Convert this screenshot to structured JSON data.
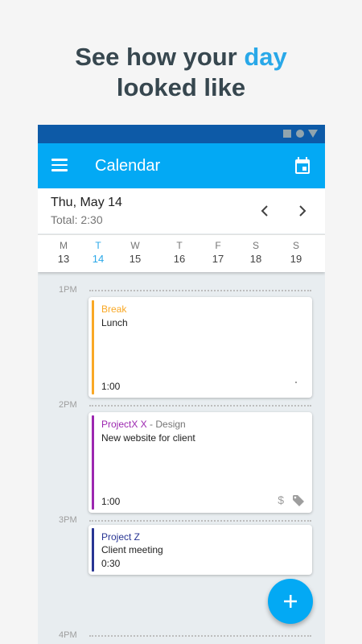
{
  "headline": {
    "line1_prefix": "See how your ",
    "line1_highlight": "day",
    "line2": "looked like"
  },
  "app": {
    "title": "Calendar",
    "date": "Thu, May 14",
    "total": "Total: 2:30",
    "colors": {
      "accent": "#03a9f4",
      "status": "#0d5aa7",
      "highlight": "#29a8e8"
    },
    "icons": {
      "menu": "menu-icon",
      "calendar": "calendar-icon",
      "prev": "chevron-left-icon",
      "next": "chevron-right-icon",
      "add": "add-icon",
      "billable": "dollar-icon",
      "tag": "tag-icon"
    }
  },
  "week": [
    {
      "letter": "M",
      "num": "13",
      "today": false
    },
    {
      "letter": "T",
      "num": "14",
      "today": true
    },
    {
      "letter": "W",
      "num": "15",
      "today": false
    },
    {
      "letter": "T",
      "num": "16",
      "today": false
    },
    {
      "letter": "F",
      "num": "17",
      "today": false
    },
    {
      "letter": "S",
      "num": "18",
      "today": false
    },
    {
      "letter": "S",
      "num": "19",
      "today": false
    }
  ],
  "times": [
    "1PM",
    "2PM",
    "3PM",
    "4PM"
  ],
  "entries": [
    {
      "project": "Break",
      "task": "",
      "description": "Lunch",
      "duration": "1:00",
      "color": "#f9a825"
    },
    {
      "project": "ProjectX X",
      "task": " - Design",
      "description": "New website for client",
      "duration": "1:00",
      "color": "#9c27b0",
      "billable": "$"
    },
    {
      "project": "Project Z",
      "task": "",
      "description": "Client meeting",
      "duration": "0:30",
      "color": "#283593"
    }
  ]
}
